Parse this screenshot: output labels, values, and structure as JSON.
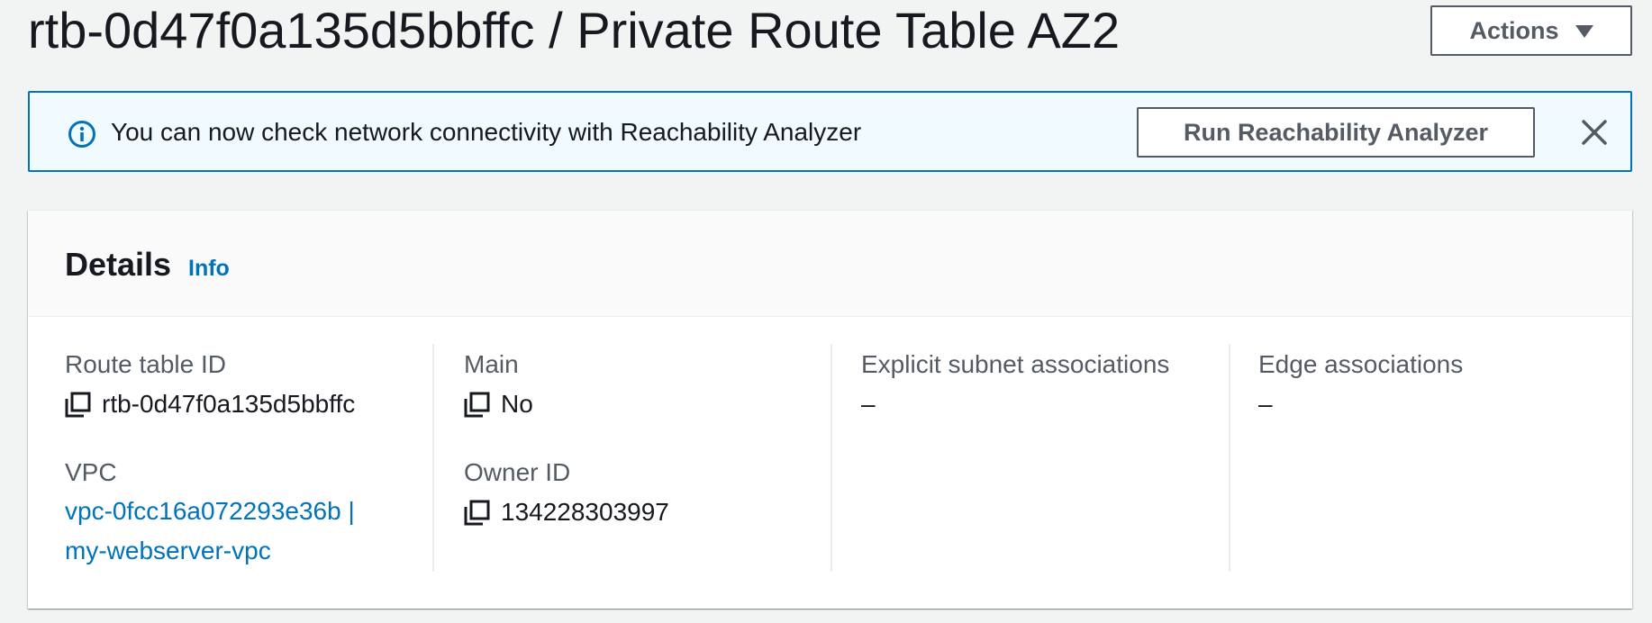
{
  "header": {
    "title": "rtb-0d47f0a135d5bbffc / Private Route Table AZ2",
    "actions_label": "Actions"
  },
  "flash": {
    "message": "You can now check network connectivity with Reachability Analyzer",
    "button_label": "Run Reachability Analyzer",
    "icon": "info-icon",
    "dismiss_icon": "close-icon"
  },
  "details": {
    "title": "Details",
    "info_link": "Info",
    "fields": {
      "route_table_id": {
        "label": "Route table ID",
        "value": "rtb-0d47f0a135d5bbffc"
      },
      "vpc": {
        "label": "VPC",
        "line1": "vpc-0fcc16a072293e36b |",
        "line2": "my-webserver-vpc"
      },
      "main": {
        "label": "Main",
        "value": "No"
      },
      "owner_id": {
        "label": "Owner ID",
        "value": "134228303997"
      },
      "explicit_subnet": {
        "label": "Explicit subnet associations",
        "value": "–"
      },
      "edge": {
        "label": "Edge associations",
        "value": "–"
      }
    }
  },
  "colors": {
    "background": "#f2f3f3",
    "link": "#0073bb",
    "flash_border": "#0073bb",
    "flash_bg": "#f1faff",
    "button_text": "#545b64"
  }
}
